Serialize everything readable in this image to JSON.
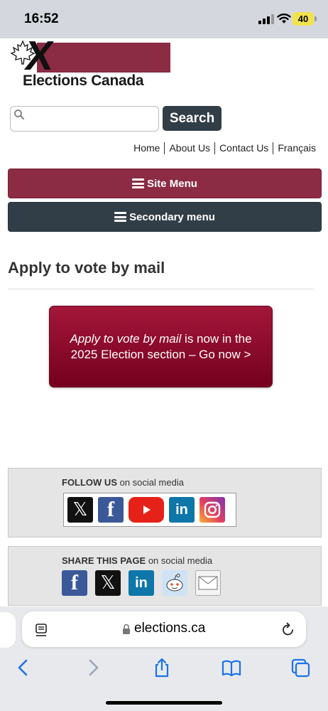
{
  "status_bar": {
    "time": "16:52",
    "battery": "40"
  },
  "logo": {
    "text": "Elections Canada"
  },
  "search": {
    "placeholder": "",
    "button_label": "Search"
  },
  "top_links": [
    {
      "label": "Home"
    },
    {
      "label": "About Us"
    },
    {
      "label": "Contact Us"
    },
    {
      "label": "Français"
    }
  ],
  "menus": {
    "site_menu": "Site Menu",
    "secondary_menu": "Secondary menu"
  },
  "page": {
    "title": "Apply to vote by mail",
    "banner_italic": "Apply to vote by mail",
    "banner_rest": " is now in the 2025 Election section – Go now >"
  },
  "follow": {
    "heading_bold": "FOLLOW US",
    "heading_rest": " on social media",
    "x_glyph": "𝕏",
    "fb_glyph": "f",
    "in_glyph": "in"
  },
  "share": {
    "heading_bold": "SHARE THIS PAGE",
    "heading_rest": " on social media",
    "fb_glyph": "f",
    "x_glyph": "𝕏",
    "in_glyph": "in"
  },
  "browser": {
    "url": "elections.ca"
  },
  "colors": {
    "brand_red": "#8c2b44",
    "dark_slate": "#323e47",
    "banner_red": "#a3163a",
    "ios_blue": "#1a73e8"
  }
}
